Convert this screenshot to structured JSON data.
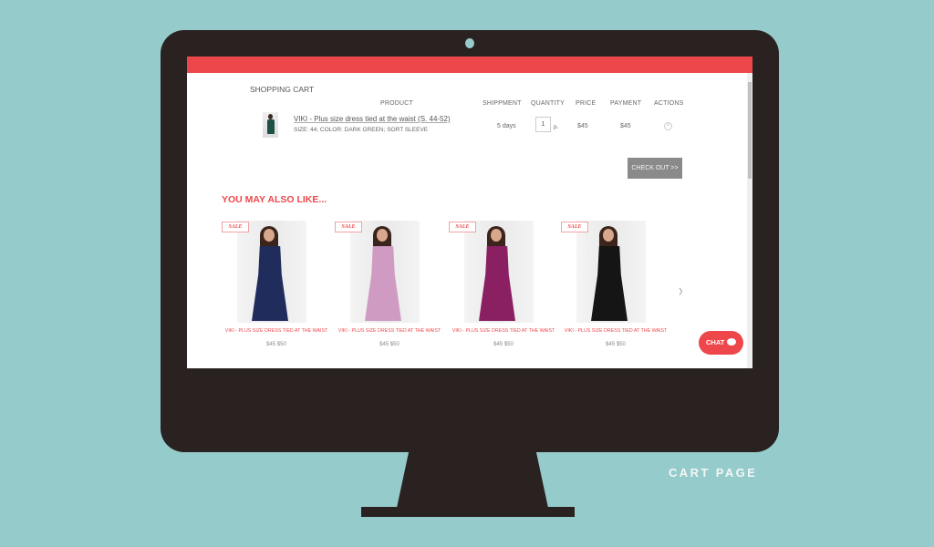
{
  "caption": "CART PAGE",
  "cart": {
    "title": "SHOPPING CART",
    "headers": [
      "PRODUCT",
      "SHIPPMENT",
      "QUANTITY",
      "PRICE",
      "PAYMENT",
      "ACTIONS"
    ],
    "item": {
      "name": "VIKI - Plus size dress tied at the waist (S. 44-52)",
      "meta": "SIZE: 44; COLOR: DARK GREEN; SORT SLEEVE",
      "shipment": "5 days",
      "quantity": "1",
      "quantity_unit": "p.",
      "price": "$45",
      "payment": "$45",
      "remove_icon": "×"
    },
    "checkout_label": "CHECK OUT >>"
  },
  "recommendations": {
    "title": "YOU MAY ALSO LIKE...",
    "items": [
      {
        "badge": "SALE",
        "name": "VIKI - PLUS SIZE DRESS TIED AT THE WAIST",
        "price": "$45 $50",
        "color": "#1f2c5c"
      },
      {
        "badge": "SALE",
        "name": "VIKI - PLUS SIZE DRESS TIED AT THE WAIST",
        "price": "$45 $50",
        "color": "#cf9bc3"
      },
      {
        "badge": "SALE",
        "name": "VIKI - PLUS SIZE DRESS TIED AT THE WAIST",
        "price": "$45 $50",
        "color": "#8a1f62"
      },
      {
        "badge": "SALE",
        "name": "VIKI - PLUS SIZE DRESS TIED AT THE WAIST",
        "price": "$45 $50",
        "color": "#151515"
      }
    ],
    "next_icon": "›"
  },
  "chat": {
    "label": "CHAT"
  },
  "colors": {
    "accent": "#ee474b",
    "background": "#95cbca",
    "monitor": "#2a2220"
  }
}
